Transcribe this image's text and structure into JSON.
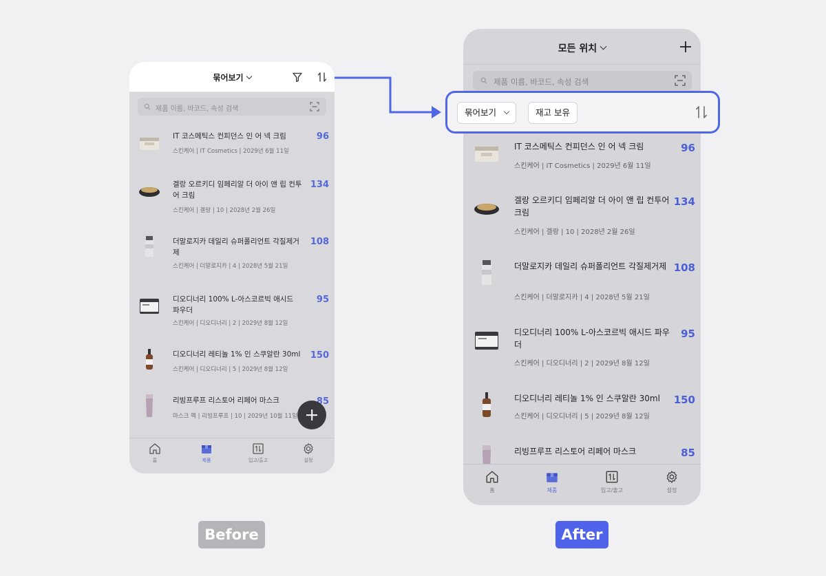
{
  "before": {
    "header": {
      "title": "묶어보기"
    },
    "search": {
      "placeholder": "제품 이름, 바코드, 속성 검색"
    },
    "items": [
      {
        "name": "IT 코스메틱스 컨피던스 인 어 넥 크림",
        "meta": "스킨케어 | IT Cosmetics | 2029년 6월 11일",
        "qty": "96"
      },
      {
        "name": "겔랑 오르키디 임페리알 더 아이 앤 립 컨투어 크림",
        "meta": "스킨케어 | 겔랑 | 10 | 2028년 2월 26일",
        "qty": "134"
      },
      {
        "name": "더말로지카 데일리 슈퍼폴리언트 각질제거제",
        "meta": "스킨케어 | 더말로지카 | 4 | 2028년 5월 21일",
        "qty": "108"
      },
      {
        "name": "디오디너리 100% L-아스코르빅 애시드 파우더",
        "meta": "스킨케어 | 디오디너리 | 2 | 2029년 8월 12일",
        "qty": "95"
      },
      {
        "name": "디오디너리 레티놀 1% 인 스쿠알란 30ml",
        "meta": "스킨케어 | 디오디너리 | 5 | 2029년 8월 12일",
        "qty": "150"
      },
      {
        "name": "리빙프루프 리스토어 리페어 마스크",
        "meta": "마스크 팩 | 리빙프루프 | 10 | 2029년 10월 11일",
        "qty": "85"
      }
    ],
    "tabs": [
      "홈",
      "제품",
      "입고/출고",
      "설정"
    ]
  },
  "after": {
    "header": {
      "title": "모든 위치"
    },
    "search": {
      "placeholder": "제품 이름, 바코드, 속성 검색"
    },
    "filters": {
      "group_label": "묶어보기",
      "stock_label": "재고 보유"
    },
    "items": [
      {
        "name": "IT 코스메틱스 컨피던스 인 어 넥 크림",
        "meta": "스킨케어 | IT Cosmetics | 2029년 6월 11일",
        "qty": "96"
      },
      {
        "name": "겔랑 오르키디 임페리알 더 아이 앤 립 컨투어 크림",
        "meta": "스킨케어 | 겔랑 | 10 | 2028년 2월 26일",
        "qty": "134"
      },
      {
        "name": "더말로지카 데일리 슈퍼폴리언트 각질제거제",
        "meta": "스킨케어 | 더말로지카 | 4 | 2028년 5월 21일",
        "qty": "108"
      },
      {
        "name": "디오디너리 100% L-아스코르빅 애시드 파우더",
        "meta": "스킨케어 | 디오디너리 | 2 | 2029년 8월 12일",
        "qty": "95"
      },
      {
        "name": "디오디너리 레티놀 1% 인 스쿠알란 30ml",
        "meta": "스킨케어 | 디오디너리 | 5 | 2029년 8월 12일",
        "qty": "150"
      },
      {
        "name": "리빙프루프 리스토어 리페어 마스크",
        "meta": "",
        "qty": "85"
      }
    ],
    "tabs": [
      "홈",
      "제품",
      "입고/출고",
      "설정"
    ]
  },
  "captions": {
    "before": "Before",
    "after": "After"
  },
  "colors": {
    "accent": "#4f63ea",
    "qty": "#4a5fd6",
    "highlight_border": "#4f67e6"
  },
  "icons": [
    "filter-icon",
    "sort-icon",
    "search-icon",
    "scan-icon",
    "plus-icon",
    "home-icon",
    "product-box-icon",
    "inout-icon",
    "settings-icon"
  ]
}
